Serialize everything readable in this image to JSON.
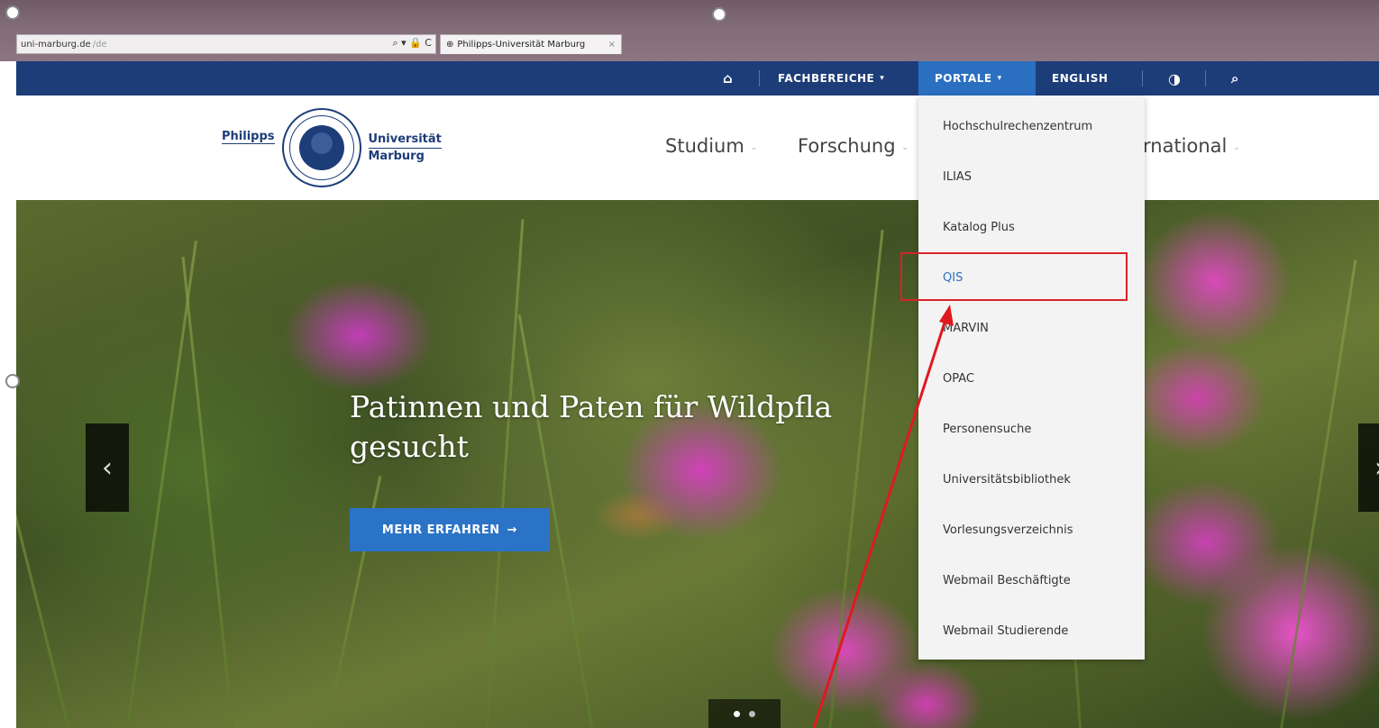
{
  "browser": {
    "address": "uni-marburg.de",
    "address_suffix": "/de",
    "address_tools": "⌕ ▾ 🔒 C",
    "tab_title": "Philipps-Universität Marburg",
    "tab_close": "×",
    "favicon": "⊕"
  },
  "topnav": {
    "home_icon": "⌂",
    "fachbereiche": "FACHBEREICHE",
    "portale": "PORTALE",
    "english": "ENGLISH",
    "contrast_icon": "◑",
    "search_icon": "⌕",
    "caret": "▾"
  },
  "logo": {
    "left_word": "Philipps",
    "right_word_1": "Universität",
    "right_word_2": "Marburg"
  },
  "mainnav": {
    "studium": "Studium",
    "forschung": "Forschung",
    "international_partial": "rnational",
    "caret": "-"
  },
  "hero": {
    "title_line1": "Patinnen und Paten für Wildpfla",
    "title_line2": "gesucht",
    "button_label": "MEHR ERFAHREN",
    "button_arrow": "→",
    "prev": "‹",
    "next": "›"
  },
  "dropdown": {
    "items": [
      "Hochschulrechenzentrum",
      "ILIAS",
      "Katalog Plus",
      "QIS",
      "MARVIN",
      "OPAC",
      "Personensuche",
      "Universitätsbibliothek",
      "Vorlesungsverzeichnis",
      "Webmail Beschäftigte",
      "Webmail Studierende"
    ],
    "highlighted_index": 3
  },
  "colors": {
    "topbar": "#1d3d78",
    "active": "#2b6fc0",
    "annotation": "#e0191f"
  }
}
